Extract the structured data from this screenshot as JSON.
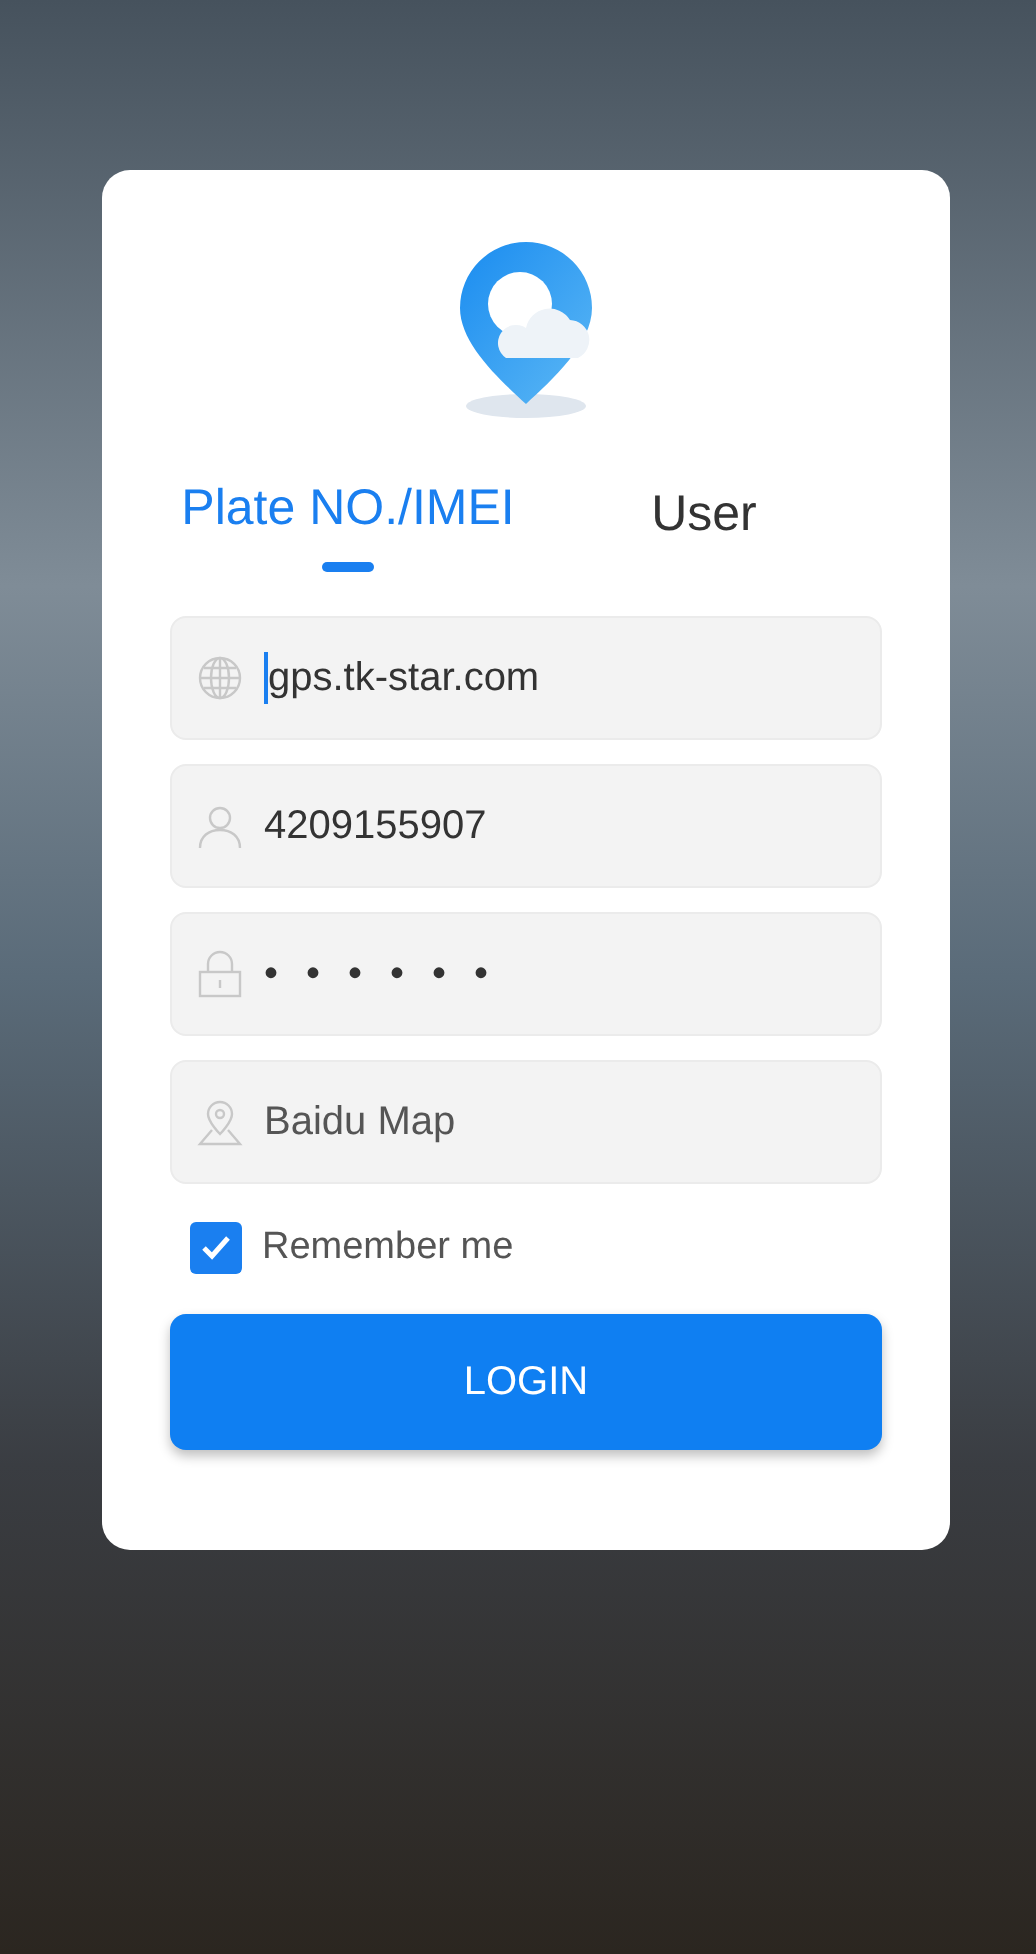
{
  "tabs": [
    {
      "label": "Plate NO./IMEI",
      "selected": true
    },
    {
      "label": "User",
      "selected": false
    }
  ],
  "fields": [
    {
      "kind": "server",
      "value": "gps.tk-star.com",
      "focused": true
    },
    {
      "kind": "account",
      "value": "4209155907",
      "focused": false
    },
    {
      "kind": "password",
      "value": "••••••",
      "focused": false
    },
    {
      "kind": "map",
      "value": "Baidu Map",
      "focused": false
    }
  ],
  "remember": {
    "label": "Remember me",
    "checked": true
  },
  "login_button": "LOGIN"
}
